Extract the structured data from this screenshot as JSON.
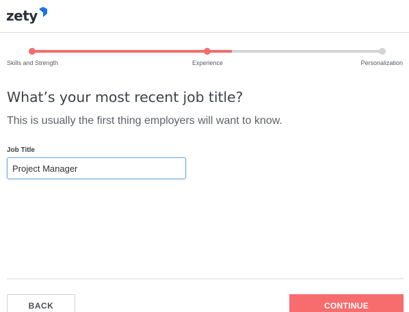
{
  "brand": {
    "name": "zety",
    "logo_icon": "zety-logo-mark",
    "logo_color": "#1a73e8"
  },
  "progress": {
    "accent_color": "#f76c6c",
    "track_color": "#d3d3d3",
    "completed_fraction": 0.57,
    "steps": [
      {
        "label": "Skills and Strength",
        "state": "completed"
      },
      {
        "label": "Experience",
        "state": "current"
      },
      {
        "label": "Personalization",
        "state": "upcoming"
      }
    ]
  },
  "main": {
    "heading": "What’s your most recent job title?",
    "subtitle": "This is usually the first thing employers will want to know.",
    "job_title": {
      "label": "Job Title",
      "value": "Project Manager"
    }
  },
  "footer": {
    "back_label": "BACK",
    "continue_label": "CONTINUE",
    "continue_color": "#f76c6c"
  }
}
